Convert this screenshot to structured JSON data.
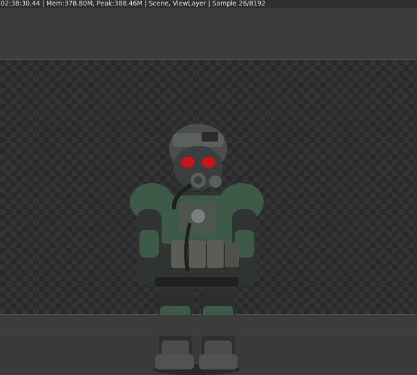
{
  "status_bar": {
    "text": "02:38:30.44 | Mem:378.80M, Peak:388.46M | Scene, ViewLayer | Sample 26/8192"
  },
  "render": {
    "subject_icon": "armored-soldier-render",
    "colors": {
      "visor": "#c8141a",
      "camo": "#3d5a48",
      "armor_dark": "#2c2f2e"
    }
  }
}
